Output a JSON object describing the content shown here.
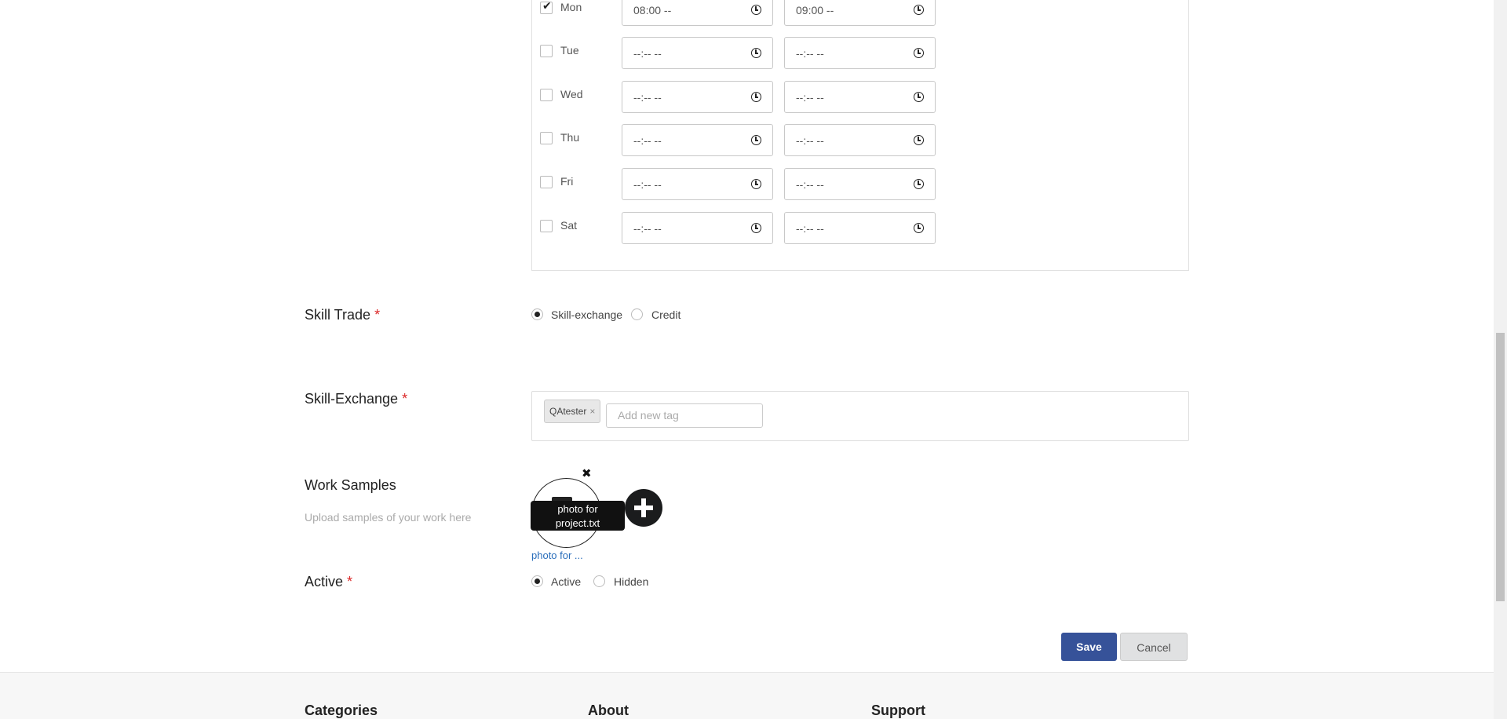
{
  "availability": {
    "days": [
      {
        "label": "Mon",
        "checked": true,
        "start": "08:00 --",
        "end": "09:00 --"
      },
      {
        "label": "Tue",
        "checked": false,
        "start": "--:-- --",
        "end": "--:-- --"
      },
      {
        "label": "Wed",
        "checked": false,
        "start": "--:-- --",
        "end": "--:-- --"
      },
      {
        "label": "Thu",
        "checked": false,
        "start": "--:-- --",
        "end": "--:-- --"
      },
      {
        "label": "Fri",
        "checked": false,
        "start": "--:-- --",
        "end": "--:-- --"
      },
      {
        "label": "Sat",
        "checked": false,
        "start": "--:-- --",
        "end": "--:-- --"
      }
    ]
  },
  "skill_trade": {
    "label": "Skill Trade",
    "required_mark": "*",
    "options": [
      {
        "label": "Skill-exchange",
        "selected": true
      },
      {
        "label": "Credit",
        "selected": false
      }
    ]
  },
  "skill_exchange": {
    "label": "Skill-Exchange",
    "required_mark": "*",
    "tags": [
      "QAtester"
    ],
    "tag_remove": "×",
    "placeholder": "Add new tag"
  },
  "work_samples": {
    "label": "Work Samples",
    "hint": "Upload samples of your work here",
    "remove_glyph": "✖",
    "tooltip_line1": "photo for",
    "tooltip_line2": "project.txt",
    "file_link": "photo for ..."
  },
  "active": {
    "label": "Active",
    "required_mark": "*",
    "options": [
      {
        "label": "Active",
        "selected": true
      },
      {
        "label": "Hidden",
        "selected": false
      }
    ]
  },
  "actions": {
    "save": "Save",
    "cancel": "Cancel"
  },
  "footer": {
    "headings": [
      "Categories",
      "About",
      "Support"
    ]
  },
  "colors": {
    "primary": "#365299",
    "required": "#db2828",
    "link": "#2a6ebb"
  }
}
